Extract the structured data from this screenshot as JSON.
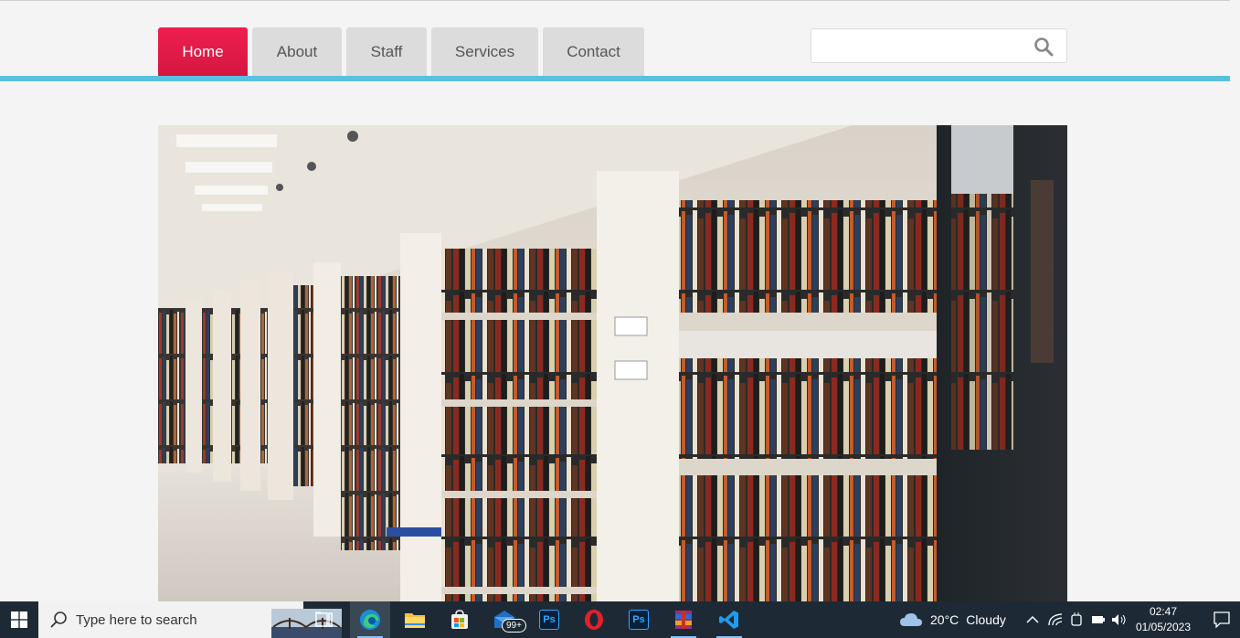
{
  "nav": {
    "tabs": [
      {
        "label": "Home",
        "active": true
      },
      {
        "label": "About",
        "active": false
      },
      {
        "label": "Staff",
        "active": false
      },
      {
        "label": "Services",
        "active": false
      },
      {
        "label": "Contact",
        "active": false
      }
    ],
    "accent_color": "#e81a48",
    "bar_color": "#5bc0de"
  },
  "search": {
    "value": "",
    "placeholder": "",
    "icon": "search-icon"
  },
  "hero": {
    "image": "library bookshelves photo"
  },
  "taskbar": {
    "search_placeholder": "Type here to search",
    "apps": [
      {
        "name": "task-view-icon"
      },
      {
        "name": "edge-icon",
        "active": true
      },
      {
        "name": "file-explorer-icon"
      },
      {
        "name": "microsoft-store-icon"
      },
      {
        "name": "mail-icon",
        "badge": "99+"
      },
      {
        "name": "photoshop-icon",
        "label": "Ps"
      },
      {
        "name": "opera-icon"
      },
      {
        "name": "photoshop-icon",
        "label": "Ps"
      },
      {
        "name": "winrar-icon"
      },
      {
        "name": "vscode-icon"
      }
    ],
    "weather": {
      "temp": "20°C",
      "condition": "Cloudy"
    },
    "time": "02:47",
    "date": "01/05/2023"
  }
}
